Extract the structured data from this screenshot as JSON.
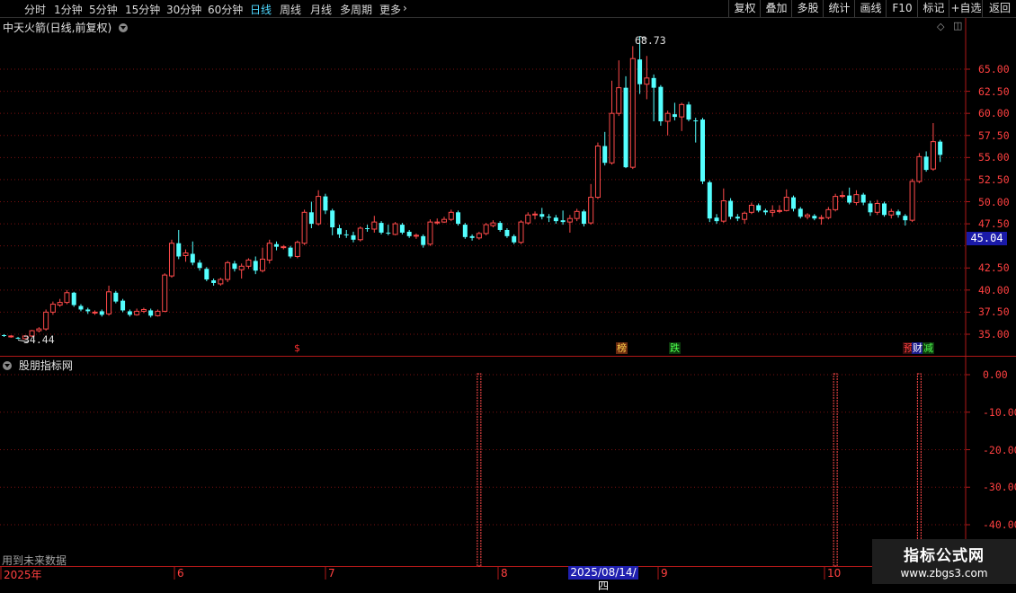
{
  "toolbar": {
    "tabs": [
      "分时",
      "1分钟",
      "5分钟",
      "15分钟",
      "30分钟",
      "60分钟",
      "日线",
      "周线",
      "月线",
      "多周期",
      "更多"
    ],
    "right_buttons": [
      "复权",
      "叠加",
      "多股",
      "统计",
      "画线",
      "F10",
      "标记",
      "+自选",
      "返回"
    ]
  },
  "main_panel": {
    "title": "中天火箭(日线,前复权)",
    "price_axis": [
      "65.00",
      "62.50",
      "60.00",
      "57.50",
      "55.00",
      "52.50",
      "50.00",
      "47.50",
      "42.50",
      "40.00",
      "37.50",
      "35.00"
    ],
    "current_price": "45.04",
    "high_label": "68.73",
    "low_label": "34.44",
    "event_markers": [
      {
        "text": "$",
        "color": "#ff3030",
        "bg": "#000000"
      },
      {
        "text": "榜",
        "color": "#ffd24a",
        "bg": "#6b2a10"
      },
      {
        "text": "跌",
        "color": "#4dff4d",
        "bg": "#0d3a0d"
      },
      {
        "text": "预",
        "color": "#ff4040",
        "bg": "#3a0d0d"
      },
      {
        "text": "财",
        "color": "#ffffff",
        "bg": "#1a1a8a"
      },
      {
        "text": "减",
        "color": "#4dff4d",
        "bg": "#0d3a0d"
      }
    ]
  },
  "sub_panel": {
    "title": "股朋指标网",
    "axis": [
      "0.00",
      "-10.00",
      "-20.00",
      "-30.00",
      "-40.00"
    ],
    "future_note": "用到未来数据"
  },
  "date_axis": {
    "labels": [
      "2025年",
      "6",
      "7",
      "8",
      "9",
      "10"
    ],
    "cursor_label": "2025/08/14/四"
  },
  "watermark": {
    "title": "指标公式网",
    "url": "www.zbgs3.com"
  },
  "colors": {
    "up": "#ff4a4a",
    "down": "#54ffff",
    "grid": "#7a1010",
    "axis": "#b01818"
  },
  "chart_data": {
    "type": "candlestick",
    "ylim": [
      33.5,
      70.5
    ],
    "candles": [
      [
        34.9,
        34.8,
        35.0,
        34.7
      ],
      [
        34.8,
        34.8,
        34.9,
        34.6
      ],
      [
        34.6,
        34.5,
        34.7,
        34.44
      ],
      [
        34.5,
        34.8,
        34.9,
        34.4
      ],
      [
        34.8,
        35.4,
        35.5,
        34.7
      ],
      [
        35.4,
        35.6,
        35.8,
        35.2
      ],
      [
        35.6,
        37.5,
        37.8,
        35.4
      ],
      [
        37.5,
        38.4,
        38.7,
        37.2
      ],
      [
        38.3,
        38.6,
        39.0,
        38.1
      ],
      [
        38.6,
        39.7,
        40.0,
        38.4
      ],
      [
        39.7,
        38.3,
        39.8,
        38.1
      ],
      [
        38.2,
        37.8,
        38.4,
        37.6
      ],
      [
        37.8,
        37.6,
        38.0,
        37.3
      ],
      [
        37.5,
        37.5,
        37.7,
        37.2
      ],
      [
        37.6,
        37.2,
        37.8,
        37.0
      ],
      [
        37.3,
        39.8,
        40.5,
        37.1
      ],
      [
        39.7,
        38.7,
        39.9,
        38.5
      ],
      [
        38.8,
        37.7,
        39.0,
        37.5
      ],
      [
        37.6,
        37.2,
        37.8,
        37.0
      ],
      [
        37.2,
        37.6,
        37.9,
        37.1
      ],
      [
        37.6,
        37.8,
        38.0,
        37.4
      ],
      [
        37.7,
        37.1,
        37.9,
        36.9
      ],
      [
        37.1,
        37.6,
        37.8,
        37.0
      ],
      [
        37.6,
        41.7,
        41.9,
        37.5
      ],
      [
        41.6,
        45.3,
        45.7,
        41.4
      ],
      [
        45.3,
        43.8,
        46.8,
        43.5
      ],
      [
        43.9,
        44.2,
        44.6,
        43.2
      ],
      [
        44.1,
        43.1,
        45.5,
        42.8
      ],
      [
        43.1,
        42.5,
        43.4,
        42.2
      ],
      [
        42.4,
        41.2,
        42.6,
        41.0
      ],
      [
        41.1,
        40.8,
        41.3,
        40.5
      ],
      [
        40.7,
        41.2,
        41.4,
        40.5
      ],
      [
        41.2,
        43.1,
        43.3,
        40.9
      ],
      [
        43.0,
        42.4,
        43.3,
        42.1
      ],
      [
        42.3,
        42.7,
        43.0,
        41.3
      ],
      [
        42.7,
        43.4,
        43.6,
        42.4
      ],
      [
        43.3,
        42.2,
        43.8,
        41.8
      ],
      [
        42.2,
        43.5,
        44.8,
        42.0
      ],
      [
        43.4,
        45.3,
        45.7,
        43.0
      ],
      [
        45.2,
        44.9,
        45.5,
        44.5
      ],
      [
        44.9,
        44.9,
        45.1,
        44.6
      ],
      [
        44.8,
        43.8,
        45.0,
        43.6
      ],
      [
        43.8,
        45.4,
        45.6,
        43.6
      ],
      [
        45.3,
        48.8,
        49.1,
        45.1
      ],
      [
        48.8,
        47.5,
        50.0,
        47.0
      ],
      [
        47.5,
        50.6,
        51.3,
        47.3
      ],
      [
        50.6,
        49.0,
        50.9,
        48.6
      ],
      [
        49.0,
        47.1,
        49.2,
        46.2
      ],
      [
        47.0,
        46.3,
        47.4,
        45.9
      ],
      [
        46.3,
        46.2,
        46.8,
        45.9
      ],
      [
        46.2,
        45.7,
        46.6,
        45.4
      ],
      [
        45.7,
        47.0,
        47.2,
        45.5
      ],
      [
        47.0,
        46.9,
        47.4,
        46.6
      ],
      [
        46.9,
        47.7,
        48.4,
        46.5
      ],
      [
        47.6,
        46.5,
        47.8,
        46.3
      ],
      [
        46.5,
        46.4,
        47.4,
        46.2
      ],
      [
        46.3,
        47.5,
        47.7,
        46.2
      ],
      [
        47.4,
        46.5,
        47.6,
        46.3
      ],
      [
        46.6,
        46.1,
        46.8,
        45.9
      ],
      [
        46.1,
        46.2,
        46.4,
        45.8
      ],
      [
        46.1,
        45.1,
        46.3,
        44.8
      ],
      [
        45.2,
        47.7,
        48.0,
        45.0
      ],
      [
        47.7,
        47.7,
        48.1,
        47.4
      ],
      [
        47.7,
        48.0,
        48.3,
        47.6
      ],
      [
        48.0,
        48.8,
        49.1,
        47.8
      ],
      [
        48.8,
        47.5,
        49.0,
        47.3
      ],
      [
        47.4,
        46.0,
        47.6,
        45.8
      ],
      [
        46.1,
        45.9,
        46.3,
        45.6
      ],
      [
        45.9,
        46.4,
        46.6,
        45.7
      ],
      [
        46.4,
        47.4,
        47.6,
        46.2
      ],
      [
        47.3,
        47.6,
        47.9,
        47.1
      ],
      [
        47.6,
        46.8,
        47.8,
        46.6
      ],
      [
        46.8,
        46.1,
        47.0,
        45.9
      ],
      [
        46.1,
        45.4,
        46.3,
        45.2
      ],
      [
        45.4,
        47.7,
        47.9,
        45.2
      ],
      [
        47.6,
        48.5,
        48.8,
        47.4
      ],
      [
        48.5,
        48.6,
        48.9,
        48.0
      ],
      [
        48.6,
        48.3,
        49.3,
        48.0
      ],
      [
        48.3,
        48.2,
        48.6,
        47.7
      ],
      [
        48.2,
        47.8,
        48.5,
        47.5
      ],
      [
        47.9,
        47.7,
        49.0,
        47.4
      ],
      [
        47.7,
        48.1,
        48.5,
        46.5
      ],
      [
        48.1,
        48.9,
        49.2,
        47.8
      ],
      [
        48.9,
        47.5,
        49.1,
        47.2
      ],
      [
        47.6,
        50.5,
        52.0,
        47.4
      ],
      [
        50.5,
        56.3,
        56.7,
        50.3
      ],
      [
        56.3,
        54.4,
        57.9,
        54.1
      ],
      [
        54.4,
        60.0,
        63.7,
        54.2
      ],
      [
        60.0,
        62.9,
        66.0,
        59.7
      ],
      [
        62.9,
        53.9,
        64.2,
        53.8
      ],
      [
        53.9,
        66.2,
        67.6,
        53.7
      ],
      [
        66.1,
        63.3,
        68.73,
        62.2
      ],
      [
        63.3,
        64.0,
        66.5,
        61.6
      ],
      [
        64.0,
        62.9,
        64.4,
        59.1
      ],
      [
        63.0,
        59.1,
        63.2,
        58.6
      ],
      [
        59.1,
        60.0,
        60.3,
        57.5
      ],
      [
        59.9,
        59.6,
        61.2,
        59.2
      ],
      [
        59.6,
        61.0,
        61.2,
        58.0
      ],
      [
        61.0,
        59.3,
        61.3,
        59.1
      ],
      [
        59.2,
        59.1,
        59.5,
        56.7
      ],
      [
        59.3,
        52.3,
        59.5,
        52.0
      ],
      [
        52.2,
        48.1,
        52.4,
        47.7
      ],
      [
        48.2,
        47.8,
        48.6,
        47.5
      ],
      [
        47.8,
        50.1,
        51.5,
        47.6
      ],
      [
        50.1,
        48.3,
        50.4,
        48.0
      ],
      [
        48.3,
        48.1,
        48.6,
        47.8
      ],
      [
        48.0,
        48.7,
        48.9,
        47.5
      ],
      [
        48.8,
        49.6,
        49.9,
        48.6
      ],
      [
        49.6,
        49.0,
        49.8,
        48.8
      ],
      [
        49.0,
        48.8,
        49.2,
        48.5
      ],
      [
        48.8,
        49.0,
        49.6,
        48.3
      ],
      [
        48.9,
        49.0,
        49.6,
        48.7
      ],
      [
        49.0,
        50.5,
        51.4,
        48.9
      ],
      [
        50.5,
        49.2,
        50.7,
        48.9
      ],
      [
        49.2,
        48.3,
        49.4,
        48.1
      ],
      [
        48.3,
        48.5,
        48.7,
        48.0
      ],
      [
        48.4,
        48.1,
        48.6,
        47.9
      ],
      [
        48.1,
        48.2,
        48.5,
        47.4
      ],
      [
        48.2,
        49.1,
        49.4,
        48.0
      ],
      [
        49.1,
        50.6,
        50.9,
        48.9
      ],
      [
        50.6,
        50.7,
        51.2,
        50.4
      ],
      [
        50.7,
        49.9,
        51.6,
        49.7
      ],
      [
        49.9,
        50.8,
        51.3,
        49.6
      ],
      [
        50.8,
        49.9,
        51.0,
        49.6
      ],
      [
        49.8,
        48.8,
        50.1,
        48.4
      ],
      [
        48.8,
        49.8,
        50.2,
        48.5
      ],
      [
        49.8,
        48.5,
        50.0,
        48.3
      ],
      [
        48.5,
        48.9,
        49.2,
        48.1
      ],
      [
        48.9,
        48.5,
        49.1,
        48.2
      ],
      [
        48.4,
        47.9,
        48.6,
        47.3
      ],
      [
        47.9,
        52.3,
        52.6,
        47.7
      ],
      [
        52.3,
        55.1,
        55.5,
        52.1
      ],
      [
        55.1,
        53.6,
        55.7,
        53.4
      ],
      [
        53.7,
        56.8,
        58.9,
        53.5
      ],
      [
        56.8,
        55.3,
        57.0,
        54.5
      ]
    ],
    "sub_signals": [
      {
        "index": 68,
        "value": -47
      },
      {
        "index": 119,
        "value": -47
      },
      {
        "index": 131,
        "value": -47
      }
    ]
  }
}
